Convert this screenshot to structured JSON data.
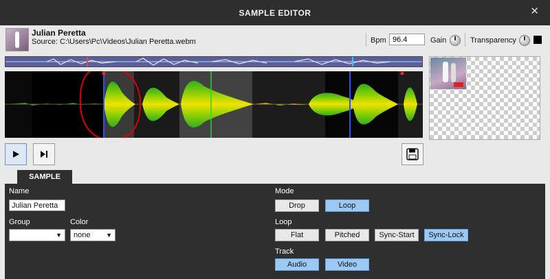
{
  "window": {
    "title": "SAMPLE EDITOR",
    "close_glyph": "✕"
  },
  "header": {
    "track_title": "Julian Peretta",
    "source": "Source: C:\\Users\\Pc\\Videos\\Julian Peretta.webm",
    "bpm_label": "Bpm",
    "bpm_value": "96.4",
    "gain_label": "Gain",
    "transparency_label": "Transparency"
  },
  "transport": {
    "play_icon": "play-icon",
    "next_icon": "skip-next-icon",
    "save_icon": "floppy-disk-icon"
  },
  "tabs": [
    {
      "label": "SAMPLE",
      "active": true
    }
  ],
  "sample": {
    "name_label": "Name",
    "name_value": "Julian Peretta",
    "group_label": "Group",
    "group_value": "",
    "color_label": "Color",
    "color_value": "none",
    "mode_label": "Mode",
    "mode_buttons": [
      {
        "label": "Drop",
        "active": false
      },
      {
        "label": "Loop",
        "active": true
      }
    ],
    "loop_label": "Loop",
    "loop_buttons": [
      {
        "label": "Flat",
        "active": false
      },
      {
        "label": "Pitched",
        "active": false
      },
      {
        "label": "Sync-Start",
        "active": false
      },
      {
        "label": "Sync-Lock",
        "active": true
      }
    ],
    "track_label": "Track",
    "track_buttons": [
      {
        "label": "Audio",
        "active": true
      },
      {
        "label": "Video",
        "active": true
      }
    ]
  },
  "colors": {
    "active_button": "#9cc9f3",
    "annotation": "#e00000",
    "panel": "#2f2f2f",
    "waveform_high": "#f2e100",
    "waveform_low": "#2fae1f"
  }
}
